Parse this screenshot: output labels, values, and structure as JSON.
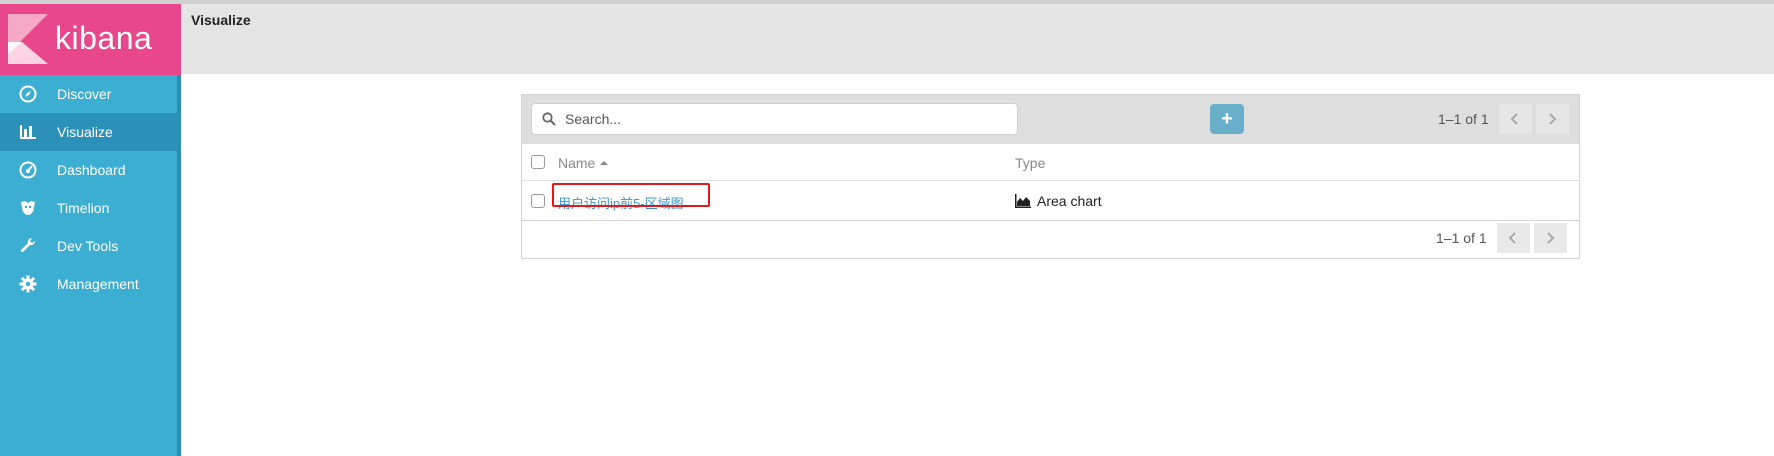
{
  "app": {
    "logo_text": "kibana",
    "colors": {
      "sidebar": "#3caed2",
      "logo_bg": "#e8488b",
      "active_nav": "#2b91b8",
      "link": "#3a97c9",
      "highlight": "#e01a1a"
    }
  },
  "sidebar": {
    "items": [
      {
        "label": "Discover",
        "icon": "compass-icon",
        "active": false
      },
      {
        "label": "Visualize",
        "icon": "bar-chart-icon",
        "active": true
      },
      {
        "label": "Dashboard",
        "icon": "gauge-icon",
        "active": false
      },
      {
        "label": "Timelion",
        "icon": "timelion-icon",
        "active": false
      },
      {
        "label": "Dev Tools",
        "icon": "wrench-icon",
        "active": false
      },
      {
        "label": "Management",
        "icon": "gear-icon",
        "active": false
      }
    ]
  },
  "header": {
    "title": "Visualize"
  },
  "toolbar": {
    "search_placeholder": "Search...",
    "add_label": "+",
    "pagination_text": "1–1 of 1"
  },
  "table": {
    "columns": {
      "name": "Name",
      "type": "Type"
    },
    "sort": {
      "column": "Name",
      "direction": "ascending"
    },
    "rows": [
      {
        "name": "用户访问ip前5-区域图",
        "type": "Area chart",
        "type_icon": "area-chart-icon",
        "highlighted": true
      }
    ]
  },
  "footer": {
    "pagination_text": "1–1 of 1"
  }
}
